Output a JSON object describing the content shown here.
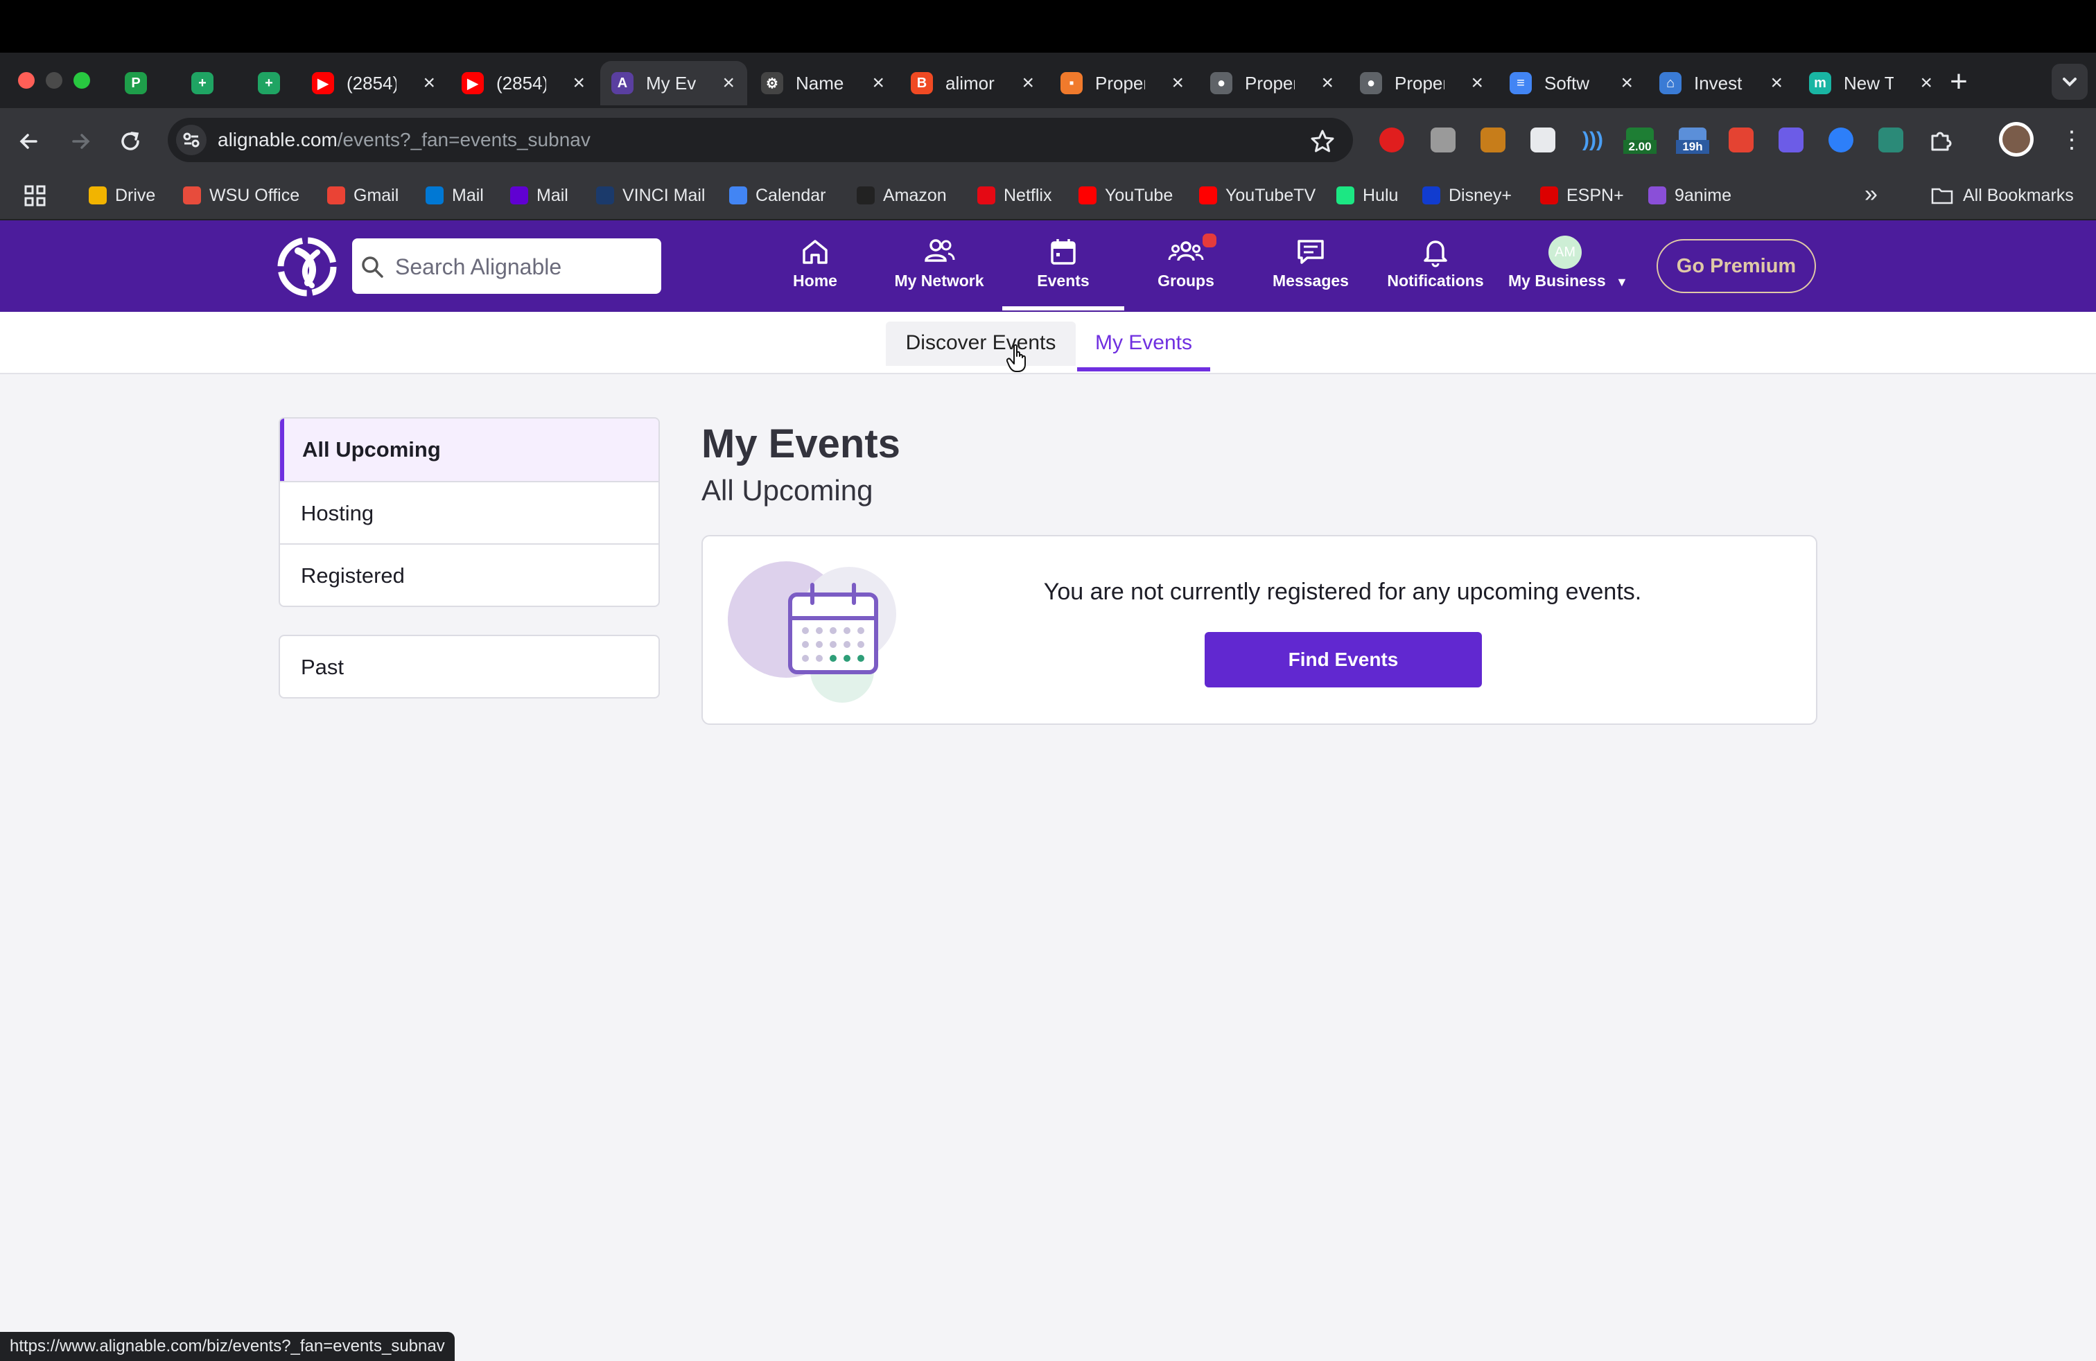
{
  "browser": {
    "tabs": [
      {
        "title": "",
        "favicon": "p-green-icon",
        "color": "#1e9e4a",
        "letter": "P"
      },
      {
        "title": "",
        "favicon": "sheets-icon",
        "color": "#1fa463",
        "letter": "+"
      },
      {
        "title": "",
        "favicon": "sheets-icon",
        "color": "#1fa463",
        "letter": "+"
      },
      {
        "title": "(2854)",
        "favicon": "youtube-icon",
        "color": "#ff0000",
        "letter": "▶"
      },
      {
        "title": "(2854)",
        "favicon": "youtube-icon",
        "color": "#ff0000",
        "letter": "▶"
      },
      {
        "title": "My Ev",
        "favicon": "alignable-icon",
        "color": "#5a3fa0",
        "letter": "A"
      },
      {
        "title": "Name",
        "favicon": "openai-icon",
        "color": "#444",
        "letter": "⚙"
      },
      {
        "title": "alimor",
        "favicon": "brave-icon",
        "color": "#f04a23",
        "letter": "B"
      },
      {
        "title": "Proper",
        "favicon": "prop-icon",
        "color": "#f07a2c",
        "letter": "▪"
      },
      {
        "title": "Proper",
        "favicon": "globe-icon",
        "color": "#5f6368",
        "letter": "●"
      },
      {
        "title": "Proper",
        "favicon": "globe-icon",
        "color": "#5f6368",
        "letter": "●"
      },
      {
        "title": "Softw",
        "favicon": "docs-icon",
        "color": "#4285f4",
        "letter": "≡"
      },
      {
        "title": "Invest",
        "favicon": "house-icon",
        "color": "#3a7bd5",
        "letter": "⌂"
      },
      {
        "title": "New T",
        "favicon": "m-icon",
        "color": "#19b5a3",
        "letter": "m"
      }
    ],
    "new_tab_label": "+",
    "url_host": "alignable.com",
    "url_path": "/events?_fan=events_subnav",
    "extension_badges": {
      "badge1": "2.00",
      "badge2": "19h"
    },
    "bookmarks": [
      {
        "label": "Drive",
        "icon": "drive-icon",
        "color": "#f2b400"
      },
      {
        "label": "WSU Office",
        "icon": "office-icon",
        "color": "#e74c3c"
      },
      {
        "label": "Gmail",
        "icon": "gmail-icon",
        "color": "#ea4335"
      },
      {
        "label": "Mail",
        "icon": "outlook-icon",
        "color": "#0078d4"
      },
      {
        "label": "Mail",
        "icon": "yahoo-icon",
        "color": "#6001d2"
      },
      {
        "label": "VINCI Mail",
        "icon": "vinci-icon",
        "color": "#1b3a6b"
      },
      {
        "label": "Calendar",
        "icon": "calendar-icon",
        "color": "#4285f4"
      },
      {
        "label": "Amazon",
        "icon": "amazon-icon",
        "color": "#222"
      },
      {
        "label": "Netflix",
        "icon": "netflix-icon",
        "color": "#e50914"
      },
      {
        "label": "YouTube",
        "icon": "youtube-icon",
        "color": "#ff0000"
      },
      {
        "label": "YouTubeTV",
        "icon": "youtube-icon",
        "color": "#ff0000"
      },
      {
        "label": "Hulu",
        "icon": "hulu-icon",
        "color": "#1ce783"
      },
      {
        "label": "Disney+",
        "icon": "disney-icon",
        "color": "#113ccf"
      },
      {
        "label": "ESPN+",
        "icon": "espn-icon",
        "color": "#d00"
      },
      {
        "label": "9anime",
        "icon": "anime-icon",
        "color": "#8a4fd8"
      }
    ],
    "more_label": "»",
    "all_bookmarks": "All Bookmarks",
    "status_url": "https://www.alignable.com/biz/events?_fan=events_subnav"
  },
  "header": {
    "search_placeholder": "Search Alignable",
    "nav": [
      {
        "label": "Home",
        "icon": "home-icon"
      },
      {
        "label": "My Network",
        "icon": "network-icon"
      },
      {
        "label": "Events",
        "icon": "calendar-icon"
      },
      {
        "label": "Groups",
        "icon": "groups-icon"
      },
      {
        "label": "Messages",
        "icon": "messages-icon"
      },
      {
        "label": "Notifications",
        "icon": "bell-icon"
      },
      {
        "label": "My Business",
        "icon": "avatar"
      }
    ],
    "avatar_initials": "AM",
    "premium_label": "Go Premium",
    "brand_color": "#4c1c9c"
  },
  "subnav": {
    "tabs": [
      {
        "label": "Discover Events",
        "active": false
      },
      {
        "label": "My Events",
        "active": true
      }
    ]
  },
  "sidebar": {
    "items": [
      {
        "label": "All Upcoming",
        "selected": true
      },
      {
        "label": "Hosting",
        "selected": false
      },
      {
        "label": "Registered",
        "selected": false
      }
    ],
    "past_label": "Past"
  },
  "main": {
    "title": "My Events",
    "subtitle": "All Upcoming",
    "empty_message": "You are not currently registered for any upcoming events.",
    "cta_label": "Find Events",
    "accent": "#6128d0"
  }
}
